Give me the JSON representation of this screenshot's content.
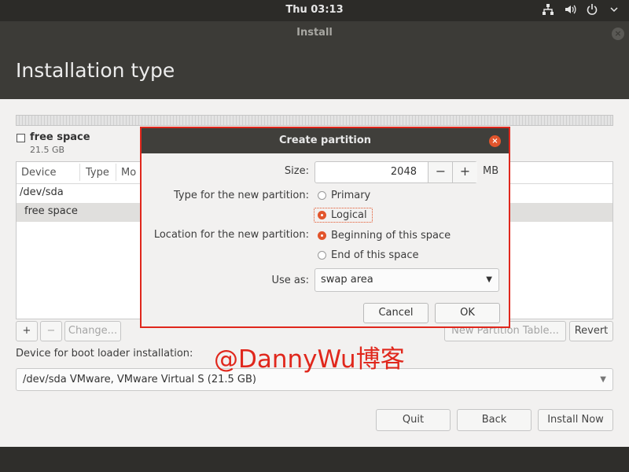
{
  "top_panel": {
    "clock": "Thu 03:13",
    "icons": [
      "network-icon",
      "volume-icon",
      "power-icon"
    ]
  },
  "window": {
    "title": "Install",
    "close": "×"
  },
  "header": {
    "title": "Installation type"
  },
  "partition_bar": {
    "legend_name": "free space",
    "legend_size": "21.5 GB"
  },
  "table": {
    "columns": [
      "Device",
      "Type",
      "Mo"
    ],
    "rows": [
      "/dev/sda",
      "free space"
    ]
  },
  "table_buttons": {
    "add": "+",
    "remove": "−",
    "change": "Change...",
    "new_table": "New Partition Table...",
    "revert": "Revert"
  },
  "boot_loader": {
    "label": "Device for boot loader installation:",
    "value": "/dev/sda VMware, VMware Virtual S (21.5 GB)"
  },
  "watermark": "@DannyWu博客",
  "nav_buttons": {
    "quit": "Quit",
    "back": "Back",
    "install_now": "Install Now"
  },
  "dialog": {
    "title": "Create partition",
    "close": "×",
    "size_label": "Size:",
    "size_value": "2048",
    "size_minus": "−",
    "size_plus": "+",
    "size_unit": "MB",
    "type_label": "Type for the new partition:",
    "type_options": [
      "Primary",
      "Logical"
    ],
    "type_selected": "Logical",
    "location_label": "Location for the new partition:",
    "location_options": [
      "Beginning of this space",
      "End of this space"
    ],
    "location_selected": "Beginning of this space",
    "use_as_label": "Use as:",
    "use_as_value": "swap area",
    "cancel": "Cancel",
    "ok": "OK"
  },
  "colors": {
    "accent": "#e2552c",
    "annotation": "#e0271c",
    "header_bg": "#3c3b37"
  }
}
